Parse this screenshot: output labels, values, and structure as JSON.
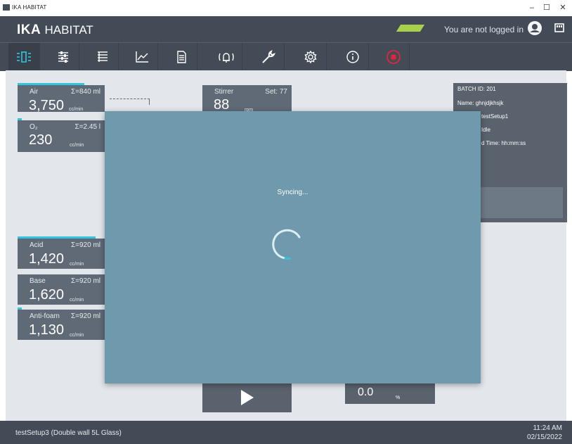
{
  "window": {
    "title": "IKA HABITAT",
    "controls": {
      "minimize": "–",
      "maximize": "☐",
      "close": "✕"
    }
  },
  "header": {
    "brand_bold": "IKA",
    "brand_rest": "HABITAT",
    "login_text": "You are not logged in",
    "status_color": "#a9d04a"
  },
  "nav": {
    "items": [
      {
        "icon": "process-overview-icon",
        "active": true
      },
      {
        "icon": "setpoint-sliders-icon"
      },
      {
        "icon": "list-icon"
      },
      {
        "icon": "trend-chart-icon"
      },
      {
        "icon": "document-icon"
      },
      {
        "icon": "alarm-bell-icon"
      },
      {
        "icon": "wrench-icon"
      },
      {
        "icon": "settings-gear-icon"
      },
      {
        "icon": "info-icon"
      },
      {
        "icon": "emergency-stop-icon",
        "color": "#e8223b"
      }
    ]
  },
  "tiles": {
    "air": {
      "name": "Air",
      "sum": "Σ=840 ml",
      "value": "3,750",
      "unit": "cc/min"
    },
    "o2": {
      "name": "O₂",
      "sum": "Σ=2.45 l",
      "value": "230",
      "unit": "cc/min"
    },
    "stirrer": {
      "name": "Stirrer",
      "set": "Set: 77",
      "value": "88",
      "unit": "rpm"
    },
    "acid": {
      "name": "Acid",
      "sum": "Σ=920 ml",
      "value": "1,420",
      "unit": "cc/min"
    },
    "base": {
      "name": "Base",
      "sum": "Σ=920 ml",
      "value": "1,620",
      "unit": "cc/min"
    },
    "antifoam": {
      "name": "Anti-foam",
      "sum": "Σ=920 ml",
      "value": "1,130",
      "unit": "cc/min"
    }
  },
  "batch": {
    "id": "BATCH ID: 201",
    "name": "Name: ghnjdjkhsjk",
    "setup": "testSetup1",
    "state": "Idle",
    "time": "d Time: hh:mm:ss"
  },
  "bottom": {
    "percent_value": "0.0",
    "percent_unit": "%"
  },
  "overlay": {
    "text": "Syncing..."
  },
  "footer": {
    "setup": "testSetup3 (Double wall 5L Glass)",
    "time": "11:24 AM",
    "date": "02/15/2022"
  },
  "colors": {
    "accent": "#34c5de",
    "header_bg": "#434b57",
    "overlay_bg": "#6f99ad",
    "stop_red": "#e8223b"
  }
}
